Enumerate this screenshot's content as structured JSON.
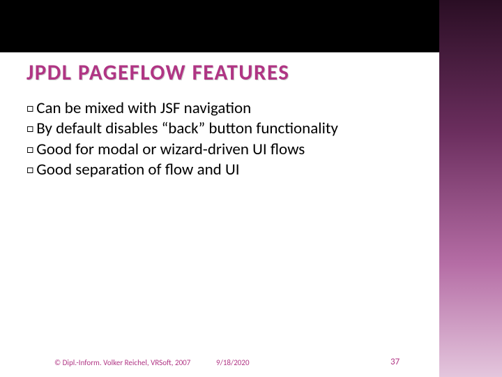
{
  "title": "JPDL PAGEFLOW FEATURES",
  "bullets": [
    "Can be mixed with JSF navigation",
    "By default disables “back” button functionality",
    "Good for modal or wizard-driven UI flows",
    "Good separation of flow and UI"
  ],
  "footer": {
    "copyright": "© Dipl.-Inform. Volker Reichel, VRSoft, 2007",
    "date": "9/18/2020",
    "page": "37"
  }
}
